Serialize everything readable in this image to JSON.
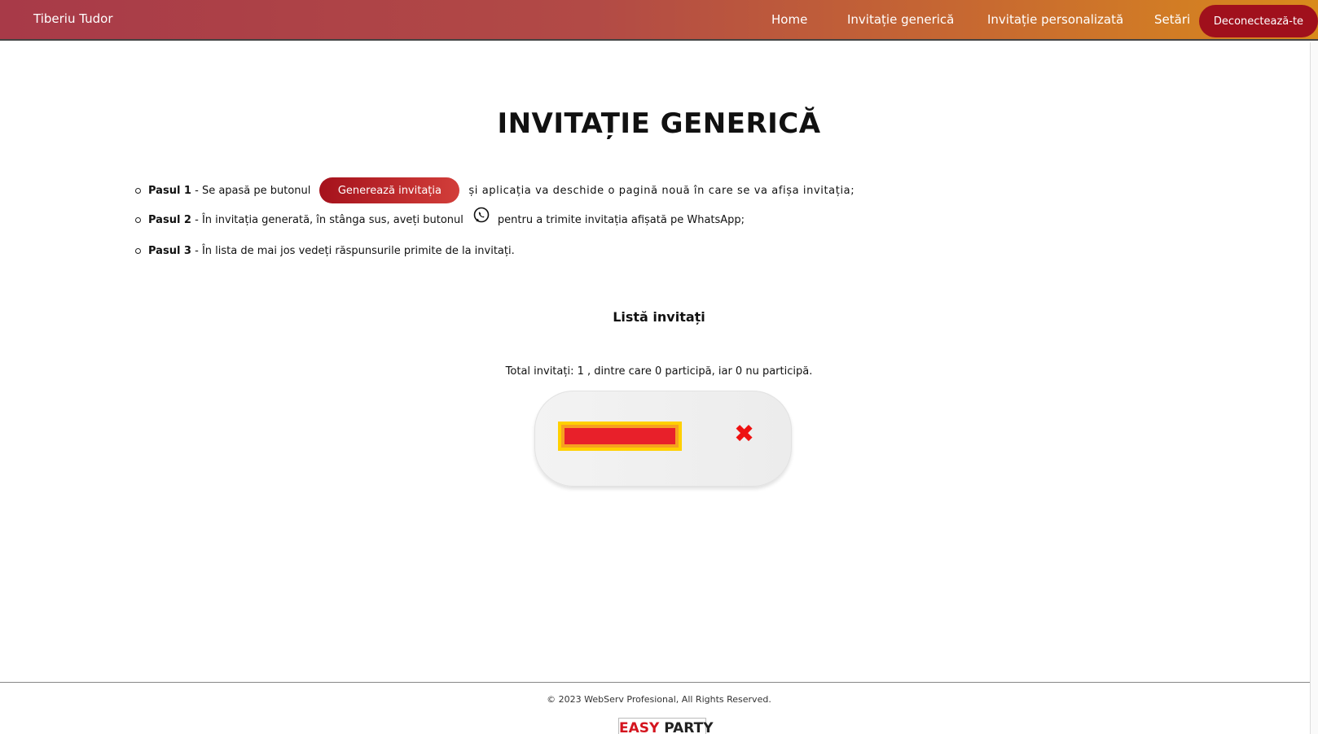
{
  "nav": {
    "brand": "Tiberiu Tudor",
    "links": [
      "Home",
      "Invitație generică",
      "Invitație personalizată",
      "Setări"
    ],
    "logout": "Deconectează-te"
  },
  "main": {
    "title": "INVITAȚIE GENERICĂ",
    "steps": [
      {
        "label": "Pasul 1",
        "before": " - Se apasă pe butonul",
        "button": "Generează invitația",
        "after": "și aplicația va deschide o pagină nouă în care se va afișa invitația;"
      },
      {
        "label": "Pasul 2",
        "before": " - În invitația generată, în stânga sus, aveți butonul",
        "icon": "whatsapp-icon",
        "after": "pentru a trimite invitația afișată pe WhatsApp;"
      },
      {
        "label": "Pasul 3",
        "before": " - În lista de mai jos vedeți răspunsurile primite de la invitați."
      }
    ],
    "guest_list": {
      "title": "Listă invitați",
      "summary": "Total invitați: 1 , dintre care 0 participă, iar 0 nu participă.",
      "guests": [
        {
          "name": "",
          "status_icon": "cross-icon",
          "status_symbol": "✖"
        }
      ]
    }
  },
  "footer": {
    "copyright": "© 2023 WebServ Profesional, All Rights Reserved.",
    "logo": {
      "part1": "EASY",
      "part2": "PARTY"
    }
  },
  "colors": {
    "nav_gradient_start": "#a83a48",
    "nav_gradient_end": "#d98a1c",
    "logout_bg": "#a0101c",
    "button_red": "#c0272d",
    "cross_red": "#ee1111"
  }
}
